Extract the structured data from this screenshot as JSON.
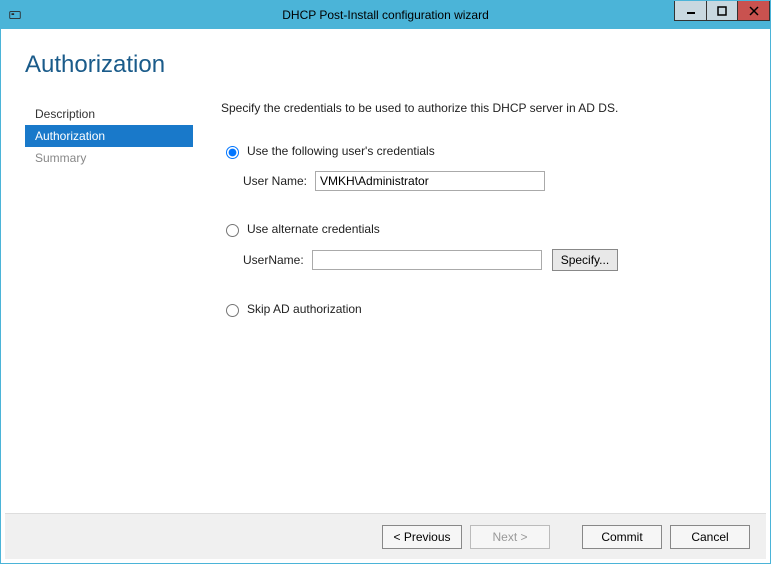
{
  "window": {
    "title": "DHCP Post-Install configuration wizard"
  },
  "page": {
    "title": "Authorization"
  },
  "sidebar": {
    "items": [
      {
        "label": "Description",
        "state": "normal"
      },
      {
        "label": "Authorization",
        "state": "active"
      },
      {
        "label": "Summary",
        "state": "dim"
      }
    ]
  },
  "main": {
    "instruction": "Specify the credentials to be used to authorize this DHCP server in AD DS.",
    "option1": {
      "label": "Use the following user's credentials",
      "field_label": "User Name:",
      "field_value": "VMKH\\Administrator",
      "selected": true
    },
    "option2": {
      "label": "Use alternate credentials",
      "field_label": "UserName:",
      "field_value": "",
      "specify_label": "Specify...",
      "selected": false
    },
    "option3": {
      "label": "Skip AD authorization",
      "selected": false
    }
  },
  "footer": {
    "previous": "< Previous",
    "next": "Next >",
    "commit": "Commit",
    "cancel": "Cancel"
  }
}
